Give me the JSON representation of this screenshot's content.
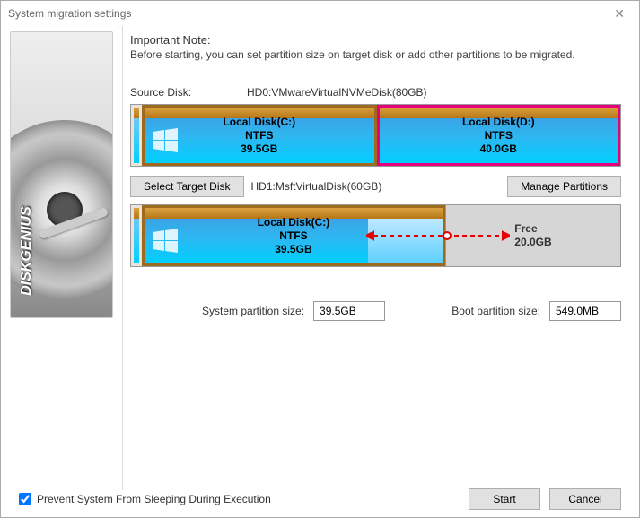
{
  "window": {
    "title": "System migration settings"
  },
  "note": {
    "heading": "Important Note:",
    "body": "Before starting, you can set partition size on target disk or add other partitions to be migrated."
  },
  "source": {
    "label": "Source Disk:",
    "disk": "HD0:VMwareVirtualNVMeDisk(80GB)",
    "partitions": [
      {
        "name": "Local Disk(C:)",
        "fs": "NTFS",
        "size": "39.5GB",
        "hasWinLogo": true,
        "selected": false,
        "widthPct": 48
      },
      {
        "name": "Local Disk(D:)",
        "fs": "NTFS",
        "size": "40.0GB",
        "hasWinLogo": false,
        "selected": true,
        "widthPct": 48
      }
    ]
  },
  "target": {
    "selectBtn": "Select Target Disk",
    "disk": "HD1:MsftVirtualDisk(60GB)",
    "manageBtn": "Manage Partitions",
    "partitions": [
      {
        "name": "Local Disk(C:)",
        "fs": "NTFS",
        "size": "39.5GB",
        "hasWinLogo": true,
        "widthPct": 62,
        "resizable": true
      },
      {
        "type": "free",
        "name": "Free",
        "size": "20.0GB",
        "widthPct": 34
      }
    ]
  },
  "sizes": {
    "systemLabel": "System partition size:",
    "systemValue": "39.5GB",
    "bootLabel": "Boot partition size:",
    "bootValue": "549.0MB"
  },
  "footer": {
    "preventSleep": "Prevent System From Sleeping During Execution",
    "preventSleepChecked": true,
    "start": "Start",
    "cancel": "Cancel"
  },
  "brand": "DISKGENIUS"
}
